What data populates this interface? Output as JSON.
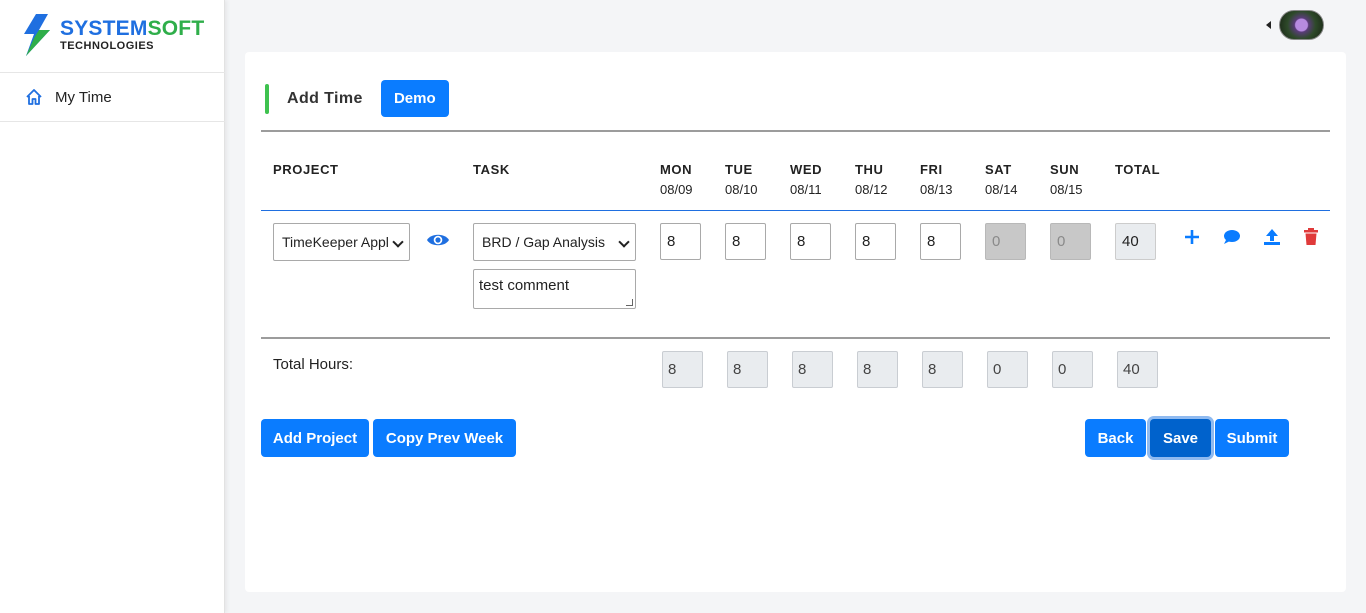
{
  "brand": {
    "name_part1": "SYSTEM",
    "name_part2": "SOFT",
    "subtitle": "TECHNOLOGIES"
  },
  "sidebar": {
    "items": [
      {
        "label": "My Time",
        "icon": "home-icon"
      }
    ]
  },
  "header": {
    "avatar_icon": "user-avatar"
  },
  "card": {
    "title": "Add Time",
    "demo_label": "Demo",
    "columns": {
      "project": "PROJECT",
      "task": "TASK",
      "days": [
        {
          "day": "MON",
          "date": "08/09"
        },
        {
          "day": "TUE",
          "date": "08/10"
        },
        {
          "day": "WED",
          "date": "08/11"
        },
        {
          "day": "THU",
          "date": "08/12"
        },
        {
          "day": "FRI",
          "date": "08/13"
        },
        {
          "day": "SAT",
          "date": "08/14"
        },
        {
          "day": "SUN",
          "date": "08/15"
        }
      ],
      "total": "TOTAL"
    },
    "row": {
      "project": "TimeKeeper Appl",
      "task": "BRD / Gap Analysis",
      "comment": "test comment",
      "hours": [
        "8",
        "8",
        "8",
        "8",
        "8",
        "0",
        "0"
      ],
      "total": "40",
      "actions": [
        "plus-icon",
        "comment-icon",
        "upload-icon",
        "trash-icon"
      ]
    },
    "totals": {
      "label": "Total Hours:",
      "hours": [
        "8",
        "8",
        "8",
        "8",
        "8",
        "0",
        "0"
      ],
      "total": "40"
    },
    "buttons": {
      "add_project": "Add Project",
      "copy_prev_week": "Copy Prev Week",
      "back": "Back",
      "save": "Save",
      "submit": "Submit"
    }
  },
  "colors": {
    "primary": "#0a7cff",
    "accent_green": "#3ec24f",
    "danger": "#e03a3a"
  }
}
